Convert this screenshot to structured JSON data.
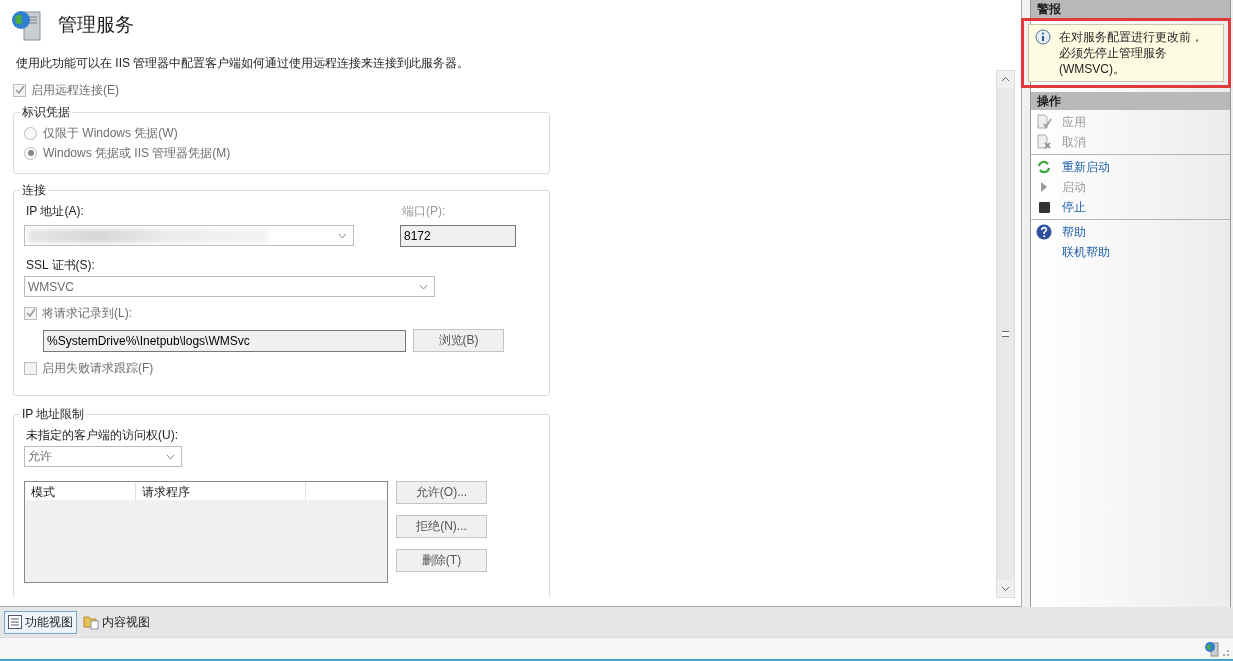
{
  "header": {
    "title": "管理服务",
    "description": "使用此功能可以在 IIS 管理器中配置客户端如何通过使用远程连接来连接到此服务器。"
  },
  "enable_remote": {
    "label": "启用远程连接(E)",
    "checked": true,
    "disabled": true
  },
  "identity": {
    "title": "标识凭据",
    "disabled": true,
    "options": [
      {
        "label": "仅限于 Windows 凭据(W)",
        "selected": false
      },
      {
        "label": "Windows 凭据或 IIS 管理器凭据(M)",
        "selected": true
      }
    ]
  },
  "connection": {
    "title": "连接",
    "ip_label": "IP 地址(A):",
    "port_label": "端口(P):",
    "port_value": "8172",
    "ssl_label": "SSL 证书(S):",
    "ssl_value": "WMSVC",
    "log": {
      "label": "将请求记录到(L):",
      "checked": true
    },
    "log_path": "%SystemDrive%\\Inetpub\\logs\\WMSvc",
    "browse_button": "浏览(B)",
    "failed_tracing": {
      "label": "启用失败请求跟踪(F)",
      "checked": false
    }
  },
  "ip_restrictions": {
    "title": "IP 地址限制",
    "access_label": "未指定的客户端的访问权(U):",
    "access_value": "允许",
    "columns": [
      "模式",
      "请求程序"
    ],
    "buttons": [
      "允许(O)...",
      "拒绝(N)...",
      "删除(T)"
    ]
  },
  "view_tabs": [
    {
      "label": "功能视图",
      "selected": true
    },
    {
      "label": "内容视图",
      "selected": false
    }
  ],
  "alerts": {
    "title": "警报",
    "message": "在对服务配置进行更改前，必须先停止管理服务(WMSVC)。",
    "highlighted": true
  },
  "actions": {
    "title": "操作",
    "groups": [
      {
        "items": [
          {
            "label": "应用",
            "kind": "apply",
            "disabled": true
          },
          {
            "label": "取消",
            "kind": "cancel",
            "disabled": true
          }
        ]
      },
      {
        "items": [
          {
            "label": "重新启动",
            "kind": "restart",
            "disabled": false
          },
          {
            "label": "启动",
            "kind": "start",
            "disabled": true
          },
          {
            "label": "停止",
            "kind": "stop",
            "disabled": false
          }
        ]
      },
      {
        "items": [
          {
            "label": "帮助",
            "kind": "help",
            "disabled": false
          },
          {
            "label": "联机帮助",
            "kind": "link",
            "disabled": false
          }
        ]
      }
    ]
  }
}
